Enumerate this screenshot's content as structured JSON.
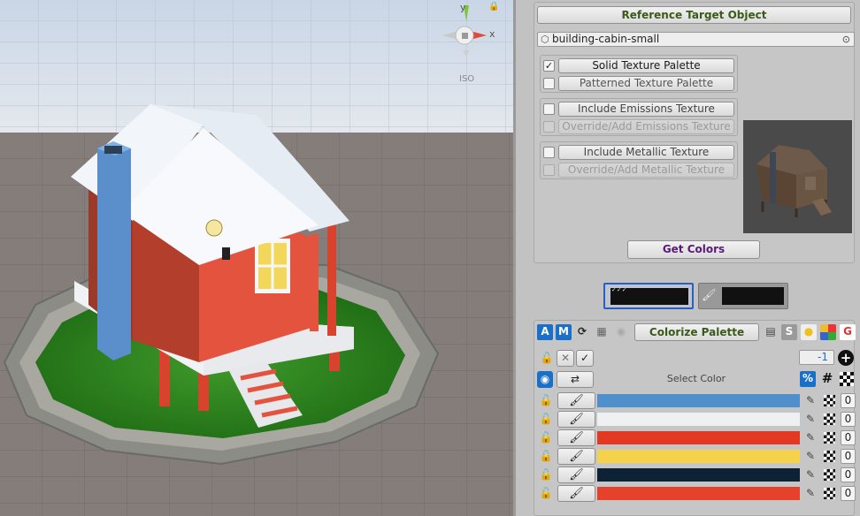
{
  "gizmo": {
    "y_label": "y",
    "x_label": "x",
    "projection_label": "ISO"
  },
  "reference": {
    "header": "Reference Target Object",
    "object_name": "building-cabin-small",
    "options": [
      {
        "label": "Solid Texture Palette",
        "checked": "✓",
        "enabled": true
      },
      {
        "label": "Patterned Texture Palette",
        "checked": "",
        "enabled": true
      },
      {
        "label": "Include Emissions Texture",
        "checked": "",
        "enabled": true
      },
      {
        "label": "Override/Add Emissions Texture",
        "checked": "",
        "enabled": false
      },
      {
        "label": "Include Metallic Texture",
        "checked": "",
        "enabled": true
      },
      {
        "label": "Override/Add Metallic Texture",
        "checked": "",
        "enabled": false
      }
    ],
    "get_colors": "Get Colors"
  },
  "palette": {
    "colorize_label": "Colorize Palette",
    "toolbar_letters": {
      "a": "A",
      "m": "M",
      "s": "S"
    },
    "count_value": "-1",
    "select_color_label": "Select Color",
    "percent_label": "%",
    "hash_label": "#",
    "rows": [
      {
        "color": "#4f8fcb",
        "value": "0"
      },
      {
        "color": "#eef0f2",
        "value": "0"
      },
      {
        "color": "#e23a22",
        "value": "0"
      },
      {
        "color": "#f5d24c",
        "value": "0"
      },
      {
        "color": "#0e2236",
        "value": "0"
      },
      {
        "color": "#e6412b",
        "value": "0"
      }
    ]
  },
  "colors": {
    "accent": "#1a6fc9",
    "header_text": "#3a5a1a",
    "get_colors_text": "#5a1a7a"
  }
}
